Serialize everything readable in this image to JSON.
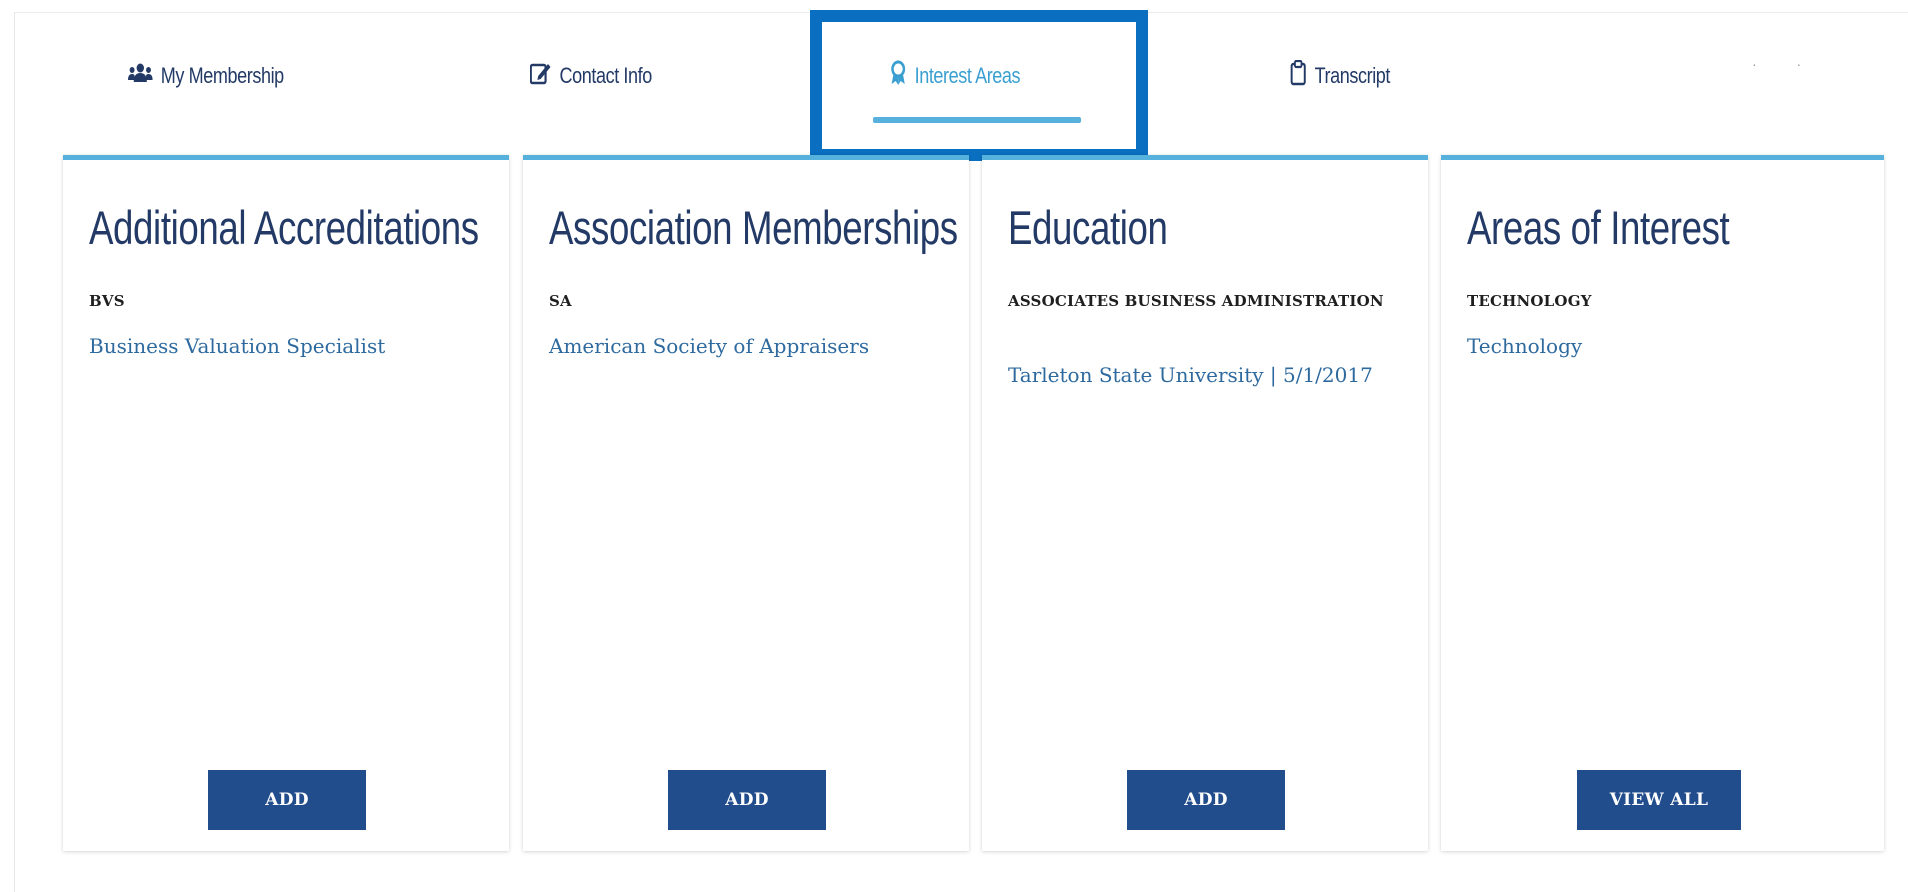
{
  "tabs": [
    {
      "label": "My Membership",
      "icon": "users-icon",
      "active": false
    },
    {
      "label": "Contact Info",
      "icon": "edit-icon",
      "active": false
    },
    {
      "label": "Interest Areas",
      "icon": "ribbon-icon",
      "active": true
    },
    {
      "label": "Transcript",
      "icon": "clipboard-icon",
      "active": false
    }
  ],
  "cards": [
    {
      "title": "Additional Accreditations",
      "code": "BVS",
      "description": "Business Valuation Specialist",
      "button": "ADD"
    },
    {
      "title": "Association Memberships",
      "code": "SA",
      "description": "American Society of Appraisers",
      "button": "ADD"
    },
    {
      "title": "Education",
      "code": "ASSOCIATES BUSINESS ADMINISTRATION",
      "description": "Tarleton State University | 5/1/2017",
      "button": "ADD"
    },
    {
      "title": "Areas of Interest",
      "code": "TECHNOLOGY",
      "description": "Technology",
      "button": "VIEW ALL"
    }
  ],
  "colors": {
    "accent": "#56b2dc",
    "highlight": "#0a6fc0",
    "button": "#224d8d",
    "title": "#233a66",
    "link": "#2e6a9e"
  }
}
